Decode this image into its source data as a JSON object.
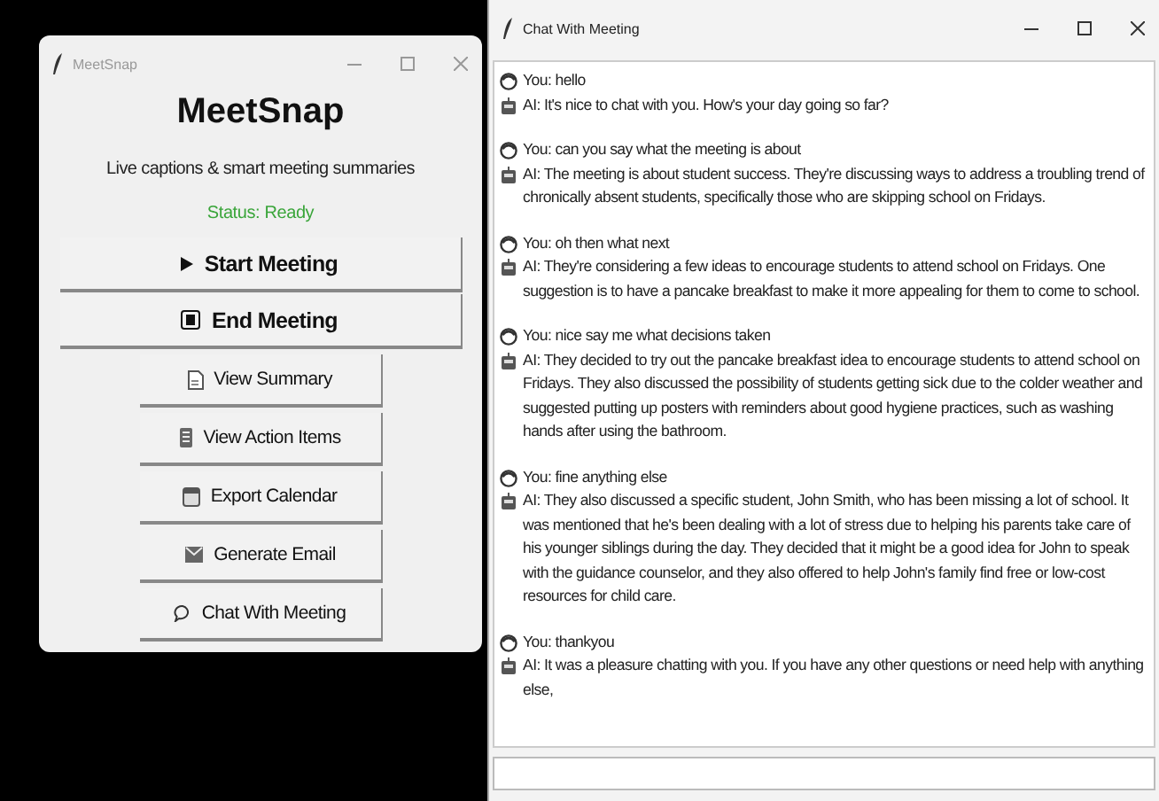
{
  "main_window": {
    "title": "MeetSnap",
    "active": false,
    "app_title": "MeetSnap",
    "subtitle": "Live captions & smart meeting summaries",
    "status": "Status: Ready",
    "buttons": [
      {
        "label": "Start Meeting",
        "kind": "primary"
      },
      {
        "label": "End Meeting",
        "kind": "primary"
      },
      {
        "label": "View Summary",
        "kind": "secondary"
      },
      {
        "label": "View Action Items",
        "kind": "secondary"
      },
      {
        "label": "Export Calendar",
        "kind": "secondary"
      },
      {
        "label": "Generate Email",
        "kind": "secondary"
      },
      {
        "label": "Chat With Meeting",
        "kind": "secondary"
      }
    ]
  },
  "chat_window": {
    "title": "Chat With Meeting",
    "active": true,
    "exchanges": [
      [
        {
          "kind": "user",
          "text": "You: hello"
        },
        {
          "kind": "ai",
          "text": "AI: It's nice to chat with you. How's your day going so far?"
        }
      ],
      [
        {
          "kind": "user",
          "text": "You: can you say what the meeting is about"
        },
        {
          "kind": "ai",
          "text": "AI: The meeting is about student success. They're discussing ways to address a troubling trend of chronically absent students, specifically those who are skipping school on Fridays."
        }
      ],
      [
        {
          "kind": "user",
          "text": "You: oh then what next"
        },
        {
          "kind": "ai",
          "text": "AI: They're considering a few ideas to encourage students to attend school on Fridays. One suggestion is to have a pancake breakfast to make it more appealing for them to come to school."
        }
      ],
      [
        {
          "kind": "user",
          "text": "You: nice say me what decisions taken"
        },
        {
          "kind": "ai",
          "text": "AI: They decided to try out the pancake breakfast idea to encourage students to attend school on Fridays. They also discussed the possibility of students getting sick due to the colder weather and suggested putting up posters with reminders about good hygiene practices, such as washing hands after using the bathroom."
        }
      ],
      [
        {
          "kind": "user",
          "text": "You: fine anything else"
        },
        {
          "kind": "ai",
          "text": "AI: They also discussed a specific student, John Smith, who has been missing a lot of school. It was mentioned that he's been dealing with a lot of stress due to helping his parents take care of his younger siblings during the day. They decided that it might be a good idea for John to speak with the guidance counselor, and they also offered to help John's family find free or low-cost resources for child care."
        }
      ],
      [
        {
          "kind": "user",
          "text": "You: thankyou"
        },
        {
          "kind": "ai",
          "text": "AI: It was a pleasure chatting with you. If you have any other questions or need help with anything else,"
        }
      ]
    ]
  }
}
